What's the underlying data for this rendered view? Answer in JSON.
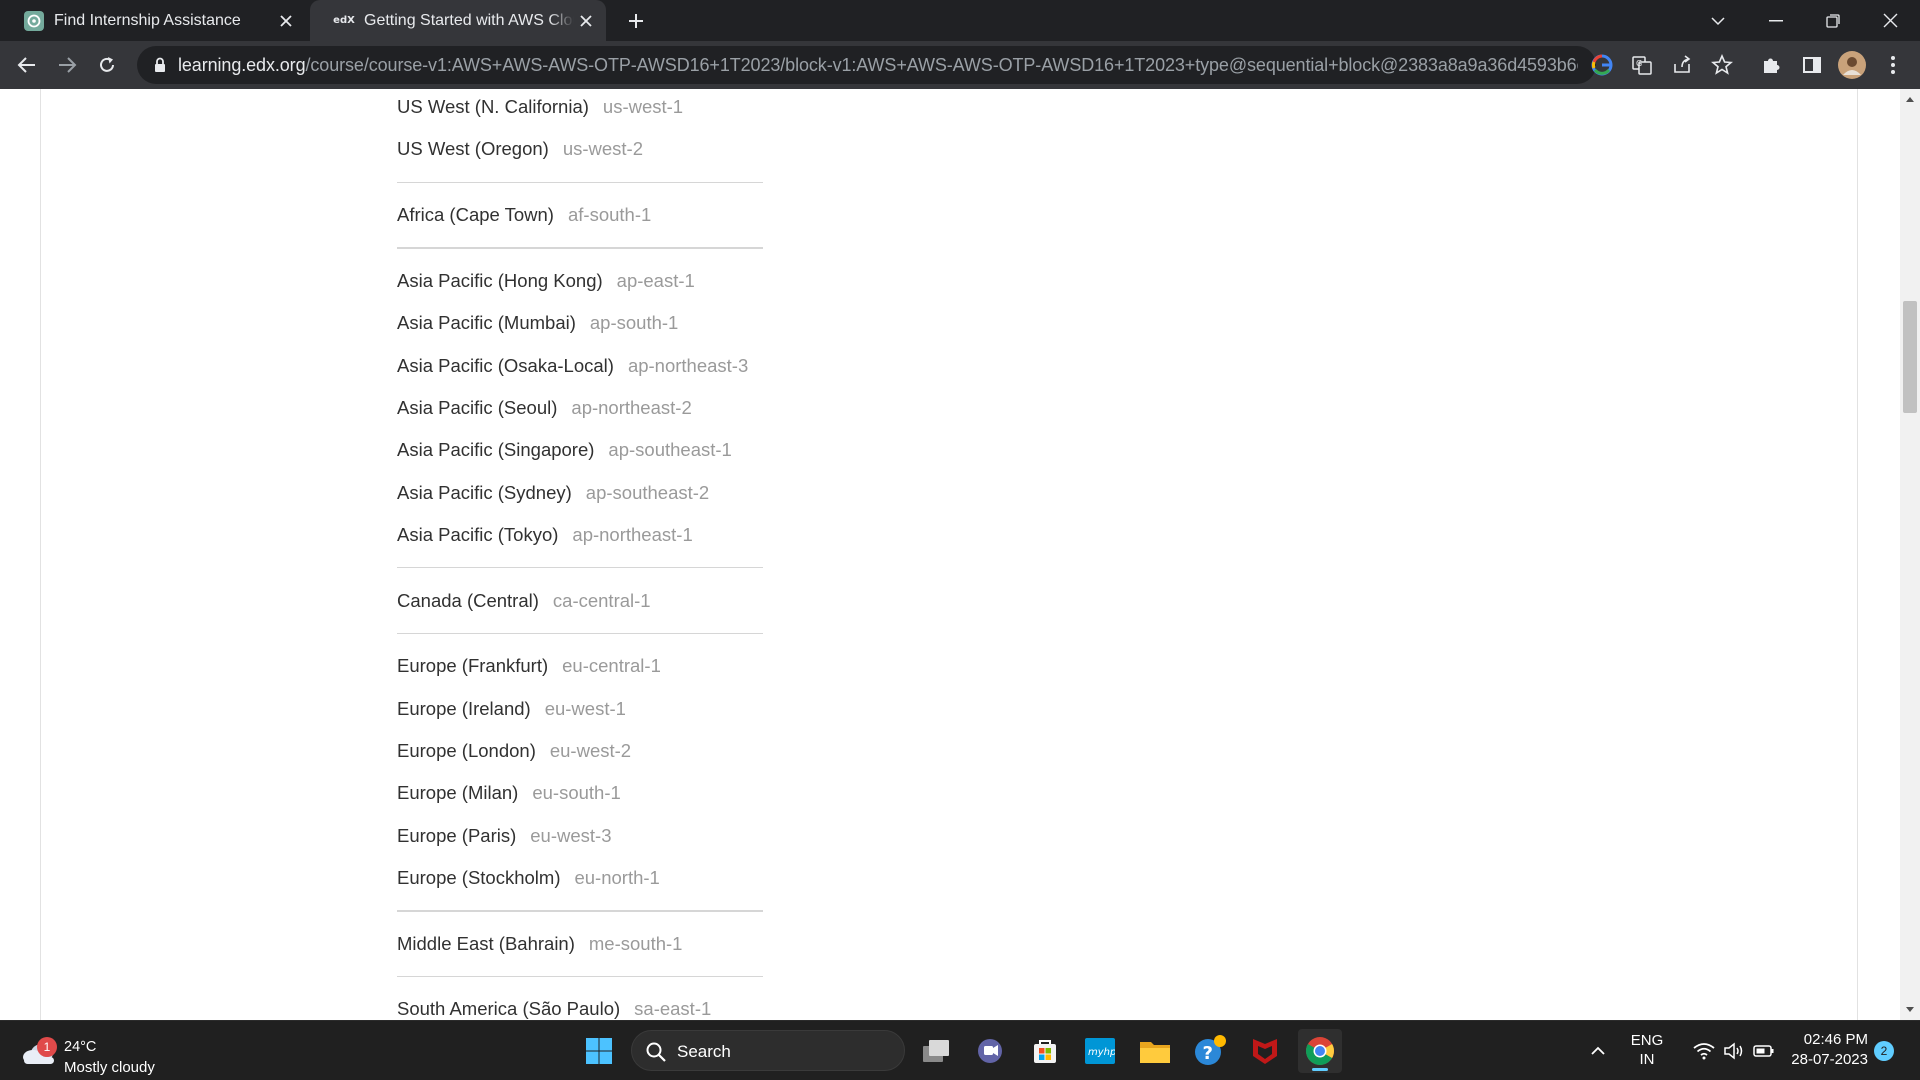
{
  "browser": {
    "tabs": [
      {
        "title": "Find Internship Assistance",
        "favicon": "chatgpt-icon",
        "active": false
      },
      {
        "title": "Getting Started with AWS Cloud | edX",
        "favicon": "edx-icon",
        "favicon_text": "edX",
        "active": true
      }
    ],
    "url_host": "learning.edx.org",
    "url_path": "/course/course-v1:AWS+AWS-AWS-OTP-AWSD16+1T2023/block-v1:AWS+AWS-AWS-OTP-AWSD16+1T2023+type@sequential+block@2383a8a9a36d4593b6cab7f..."
  },
  "content": {
    "groups": [
      {
        "regions": [
          {
            "name": "US West (N. California)",
            "code": "us-west-1"
          },
          {
            "name": "US West (Oregon)",
            "code": "us-west-2"
          }
        ]
      },
      {
        "regions": [
          {
            "name": "Africa (Cape Town)",
            "code": "af-south-1"
          }
        ]
      },
      {
        "regions": [
          {
            "name": "Asia Pacific (Hong Kong)",
            "code": "ap-east-1"
          },
          {
            "name": "Asia Pacific (Mumbai)",
            "code": "ap-south-1"
          },
          {
            "name": "Asia Pacific (Osaka-Local)",
            "code": "ap-northeast-3"
          },
          {
            "name": "Asia Pacific (Seoul)",
            "code": "ap-northeast-2"
          },
          {
            "name": "Asia Pacific (Singapore)",
            "code": "ap-southeast-1"
          },
          {
            "name": "Asia Pacific (Sydney)",
            "code": "ap-southeast-2"
          },
          {
            "name": "Asia Pacific (Tokyo)",
            "code": "ap-northeast-1"
          }
        ]
      },
      {
        "regions": [
          {
            "name": "Canada (Central)",
            "code": "ca-central-1"
          }
        ]
      },
      {
        "regions": [
          {
            "name": "Europe (Frankfurt)",
            "code": "eu-central-1"
          },
          {
            "name": "Europe (Ireland)",
            "code": "eu-west-1"
          },
          {
            "name": "Europe (London)",
            "code": "eu-west-2"
          },
          {
            "name": "Europe (Milan)",
            "code": "eu-south-1"
          },
          {
            "name": "Europe (Paris)",
            "code": "eu-west-3"
          },
          {
            "name": "Europe (Stockholm)",
            "code": "eu-north-1"
          }
        ]
      },
      {
        "regions": [
          {
            "name": "Middle East (Bahrain)",
            "code": "me-south-1"
          }
        ]
      },
      {
        "regions": [
          {
            "name": "South America (São Paulo)",
            "code": "sa-east-1"
          }
        ]
      }
    ]
  },
  "taskbar": {
    "weather": {
      "badge": "1",
      "temp": "24°C",
      "condition": "Mostly cloudy"
    },
    "search_label": "Search",
    "language": {
      "line1": "ENG",
      "line2": "IN"
    },
    "clock": {
      "time": "02:46 PM",
      "date": "28-07-2023"
    },
    "notification_count": "2",
    "apps": [
      "file-explorer-view-icon",
      "teams-chat-icon",
      "microsoft-store-icon",
      "myhp-icon",
      "file-explorer-icon",
      "get-help-icon",
      "mcafee-icon",
      "chrome-icon"
    ]
  },
  "colors": {
    "region_name": "#313131",
    "region_code": "#9a9a9a",
    "divider": "#d6d6d6",
    "chrome_dark": "#202124",
    "chrome_toolbar": "#35363a",
    "taskbar": "#202020",
    "accent": "#60cdff"
  }
}
